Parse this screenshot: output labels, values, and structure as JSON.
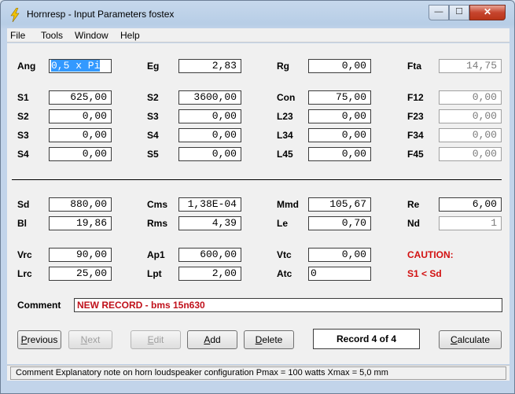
{
  "window": {
    "title": "Hornresp - Input Parameters   fostex",
    "min": "—",
    "max": "☐",
    "close": "✕"
  },
  "menu": [
    "File",
    "Tools",
    "Window",
    "Help"
  ],
  "rows1": [
    [
      {
        "label": "Ang",
        "value": "0,5 x Pi",
        "sel": true
      },
      {
        "label": "Eg",
        "value": "2,83"
      },
      {
        "label": "Rg",
        "value": "0,00"
      },
      {
        "label": "Fta",
        "value": "14,75",
        "ro": true
      }
    ],
    [
      {
        "label": "S1",
        "value": "625,00"
      },
      {
        "label": "S2",
        "value": "3600,00"
      },
      {
        "label": "Con",
        "value": "75,00"
      },
      {
        "label": "F12",
        "value": "0,00",
        "ro": true
      }
    ],
    [
      {
        "label": "S2",
        "value": "0,00"
      },
      {
        "label": "S3",
        "value": "0,00"
      },
      {
        "label": "L23",
        "value": "0,00"
      },
      {
        "label": "F23",
        "value": "0,00",
        "ro": true
      }
    ],
    [
      {
        "label": "S3",
        "value": "0,00"
      },
      {
        "label": "S4",
        "value": "0,00"
      },
      {
        "label": "L34",
        "value": "0,00"
      },
      {
        "label": "F34",
        "value": "0,00",
        "ro": true
      }
    ],
    [
      {
        "label": "S4",
        "value": "0,00"
      },
      {
        "label": "S5",
        "value": "0,00"
      },
      {
        "label": "L45",
        "value": "0,00"
      },
      {
        "label": "F45",
        "value": "0,00",
        "ro": true
      }
    ]
  ],
  "rows2": [
    [
      {
        "label": "Sd",
        "value": "880,00"
      },
      {
        "label": "Cms",
        "value": "1,38E-04"
      },
      {
        "label": "Mmd",
        "value": "105,67"
      },
      {
        "label": "Re",
        "value": "6,00"
      }
    ],
    [
      {
        "label": "Bl",
        "value": "19,86"
      },
      {
        "label": "Rms",
        "value": "4,39"
      },
      {
        "label": "Le",
        "value": "0,70"
      },
      {
        "label": "Nd",
        "value": "1",
        "ro": true
      }
    ],
    [
      {
        "label": "Vrc",
        "value": "90,00"
      },
      {
        "label": "Ap1",
        "value": "600,00"
      },
      {
        "label": "Vtc",
        "value": "0,00"
      },
      {
        "caution": "CAUTION:"
      }
    ],
    [
      {
        "label": "Lrc",
        "value": "25,00"
      },
      {
        "label": "Lpt",
        "value": "2,00"
      },
      {
        "label": "Atc",
        "value": "0",
        "left": true
      },
      {
        "caution": "S1 < Sd"
      }
    ]
  ],
  "comment": {
    "label": "Comment",
    "value": "NEW RECORD - bms 15n630"
  },
  "buttons": {
    "previous": {
      "pre": "",
      "ul": "P",
      "post": "revious"
    },
    "next": {
      "pre": "",
      "ul": "N",
      "post": "ext"
    },
    "edit": {
      "pre": "",
      "ul": "E",
      "post": "dit"
    },
    "add": {
      "pre": "",
      "ul": "A",
      "post": "dd"
    },
    "delete": {
      "pre": "",
      "ul": "D",
      "post": "elete"
    },
    "calculate": {
      "pre": "",
      "ul": "C",
      "post": "alculate"
    }
  },
  "record": "Record 4 of 4",
  "status": "Comment   Explanatory note on horn loudspeaker configuration   Pmax = 100 watts   Xmax = 5,0 mm"
}
